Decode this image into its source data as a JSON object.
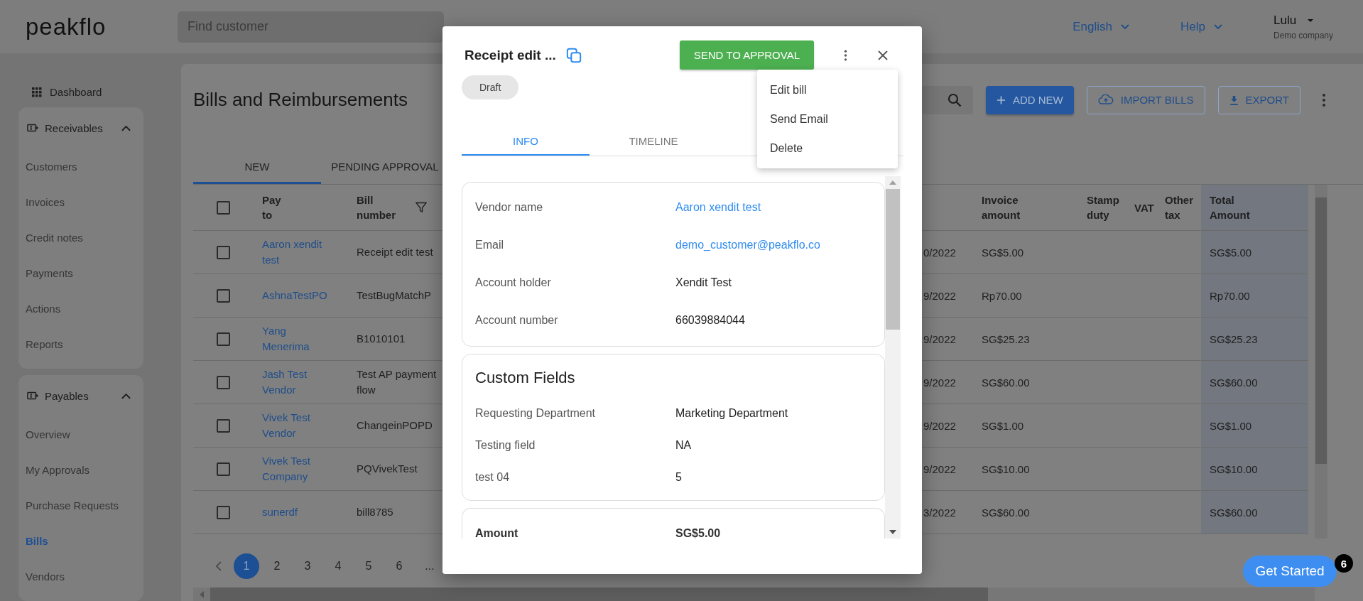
{
  "header": {
    "logo": "peakflo",
    "search": {
      "placeholder": "Find customer"
    },
    "language": "English",
    "help": "Help",
    "user": {
      "name": "Lulu",
      "company": "Demo company"
    }
  },
  "sidebar": {
    "dashboard": "Dashboard",
    "groups": [
      {
        "title": "Receivables",
        "expanded": true,
        "items": [
          {
            "label": "Customers",
            "selected": false
          },
          {
            "label": "Invoices",
            "selected": false
          },
          {
            "label": "Credit notes",
            "selected": false
          },
          {
            "label": "Payments",
            "selected": false
          },
          {
            "label": "Actions",
            "selected": false
          },
          {
            "label": "Reports",
            "selected": false
          }
        ]
      },
      {
        "title": "Payables",
        "expanded": true,
        "items": [
          {
            "label": "Overview",
            "selected": false
          },
          {
            "label": "My Approvals",
            "selected": false
          },
          {
            "label": "Purchase Requests",
            "selected": false
          },
          {
            "label": "Bills",
            "selected": true
          },
          {
            "label": "Vendors",
            "selected": false
          }
        ]
      }
    ]
  },
  "page": {
    "title": "Bills and Reimbursements",
    "actions": [
      {
        "label": "ADD NEW",
        "kind": "primary"
      },
      {
        "label": "IMPORT BILLS",
        "kind": "outlined"
      },
      {
        "label": "EXPORT",
        "kind": "outlined"
      }
    ],
    "tabs": [
      {
        "label": "NEW",
        "selected": true
      },
      {
        "label": "PENDING APPROVAL",
        "selected": false
      }
    ],
    "table": {
      "select_all_checked": false,
      "columns": [
        "Pay to",
        "Bill number",
        "Invoice amount",
        "Stamp duty",
        "VAT",
        "Other tax",
        "Total Amount"
      ],
      "rows": [
        {
          "checked": false,
          "pay_to": "Aaron xendit test",
          "bill_number": "Receipt edit test",
          "column_4": "0/2022",
          "invoice_amount": "SG$5.00",
          "total_amount": "SG$5.00"
        },
        {
          "checked": false,
          "pay_to": "AshnaTestPO",
          "bill_number": "TestBugMatchP",
          "column_4": "9/2022",
          "invoice_amount": "Rp70.00",
          "total_amount": "Rp70.00"
        },
        {
          "checked": false,
          "pay_to": "Yang Menerima",
          "bill_number": "B1010101",
          "column_4": "9/2022",
          "invoice_amount": "SG$25.23",
          "total_amount": "SG$25.23"
        },
        {
          "checked": false,
          "pay_to": "Jash Test Vendor",
          "bill_number": "Test AP payment flow",
          "column_4": "9/2022",
          "invoice_amount": "SG$60.00",
          "total_amount": "SG$60.00"
        },
        {
          "checked": false,
          "pay_to": "Vivek Test Vendor",
          "bill_number": "ChangeinPOPD",
          "column_4": "9/2022",
          "invoice_amount": "SG$1.00",
          "total_amount": "SG$1.00"
        },
        {
          "checked": false,
          "pay_to": "Vivek Test Company",
          "bill_number": "PQVivekTest",
          "column_4": "9/2022",
          "invoice_amount": "SG$10.00",
          "total_amount": "SG$10.00"
        },
        {
          "checked": false,
          "pay_to": "sunerdf",
          "bill_number": "bill8785",
          "column_4": "3/2022",
          "invoice_amount": "SG$60.00",
          "total_amount": "SG$60.00"
        }
      ]
    },
    "pagination": {
      "pages": [
        {
          "label": "1",
          "selected": true
        },
        {
          "label": "2",
          "selected": false
        },
        {
          "label": "3",
          "selected": false
        },
        {
          "label": "4",
          "selected": false
        },
        {
          "label": "5",
          "selected": false
        },
        {
          "label": "6",
          "selected": false
        }
      ],
      "ellipsis": "..."
    }
  },
  "modal": {
    "title": "Receipt edit ...",
    "status": "Draft",
    "primary_action": "SEND TO APPROVAL",
    "menu": [
      "Edit bill",
      "Send Email",
      "Delete"
    ],
    "tabs": [
      {
        "label": "INFO",
        "selected": true
      },
      {
        "label": "TIMELINE",
        "selected": false
      }
    ],
    "vendor_fields": [
      {
        "label": "Vendor name",
        "value": "Aaron xendit test",
        "kind": "link"
      },
      {
        "label": "Email",
        "value": "demo_customer@peakflo.co",
        "kind": "link"
      },
      {
        "label": "Account holder",
        "value": "Xendit Test",
        "kind": "text"
      },
      {
        "label": "Account number",
        "value": "66039884044",
        "kind": "text"
      }
    ],
    "custom_fields": {
      "title": "Custom Fields",
      "rows": [
        {
          "label": "Requesting Department",
          "value": "Marketing Department"
        },
        {
          "label": "Testing field",
          "value": "NA"
        },
        {
          "label": "test 04",
          "value": "5"
        }
      ]
    },
    "amount": {
      "label": "Amount",
      "value": "SG$5.00"
    }
  },
  "get_started": {
    "label": "Get Started",
    "badge": "6"
  }
}
